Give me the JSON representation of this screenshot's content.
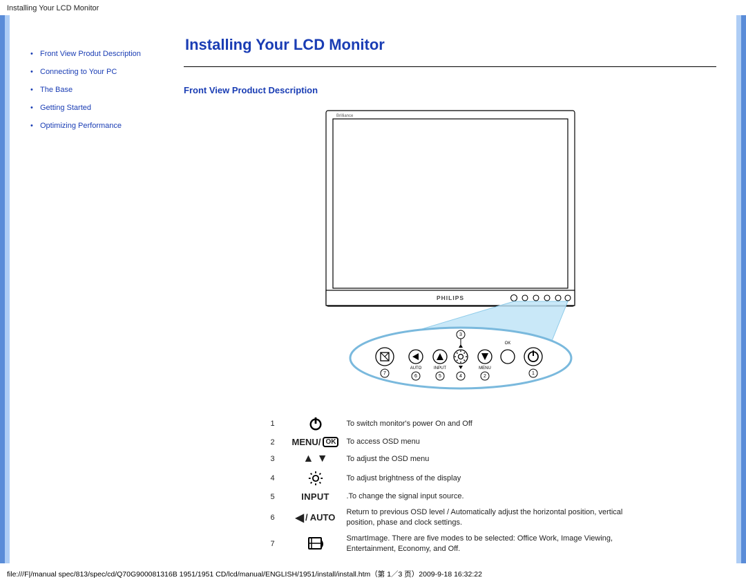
{
  "page_header": "Installing Your LCD Monitor",
  "sidebar": {
    "items": [
      {
        "label": "Front View Produt Description"
      },
      {
        "label": "Connecting to Your PC"
      },
      {
        "label": "The Base"
      },
      {
        "label": "Getting Started"
      },
      {
        "label": "Optimizing Performance"
      }
    ]
  },
  "main": {
    "title": "Installing Your LCD Monitor",
    "section_title": "Front View Product Description",
    "monitor_branding_left": "Brilliance",
    "monitor_branding_center": "PHILIPS",
    "callout_numbers": [
      "1",
      "2",
      "3",
      "4",
      "5",
      "6",
      "7"
    ],
    "control_labels": {
      "auto": "AUTO",
      "input": "INPUT",
      "menu": "MENU",
      "ok": "OK"
    }
  },
  "legend": [
    {
      "num": "1",
      "icon_key": "power",
      "icon_label": "",
      "desc": "To switch monitor's power On and Off"
    },
    {
      "num": "2",
      "icon_key": "menu",
      "icon_label": "MENU/",
      "ok": "OK",
      "desc": "To access OSD menu"
    },
    {
      "num": "3",
      "icon_key": "arrows",
      "icon_label": "",
      "desc": "To adjust the OSD menu"
    },
    {
      "num": "4",
      "icon_key": "bright",
      "icon_label": "",
      "desc": "To adjust brightness of the display"
    },
    {
      "num": "5",
      "icon_key": "input",
      "icon_label": "INPUT",
      "desc": ".To change the signal input source."
    },
    {
      "num": "6",
      "icon_key": "back",
      "icon_label": "/ AUTO",
      "desc": "Return to previous OSD level / Automatically adjust the horizontal position, vertical position, phase and clock settings."
    },
    {
      "num": "7",
      "icon_key": "smart",
      "icon_label": "",
      "desc": "SmartImage. There are five modes to be selected: Office Work, Image Viewing, Entertainment, Economy, and Off."
    }
  ],
  "footer": "file:///F|/manual spec/813/spec/cd/Q70G900081316B 1951/1951 CD/lcd/manual/ENGLISH/1951/install/install.htm（第 1／3 页）2009-9-18 16:32:22"
}
